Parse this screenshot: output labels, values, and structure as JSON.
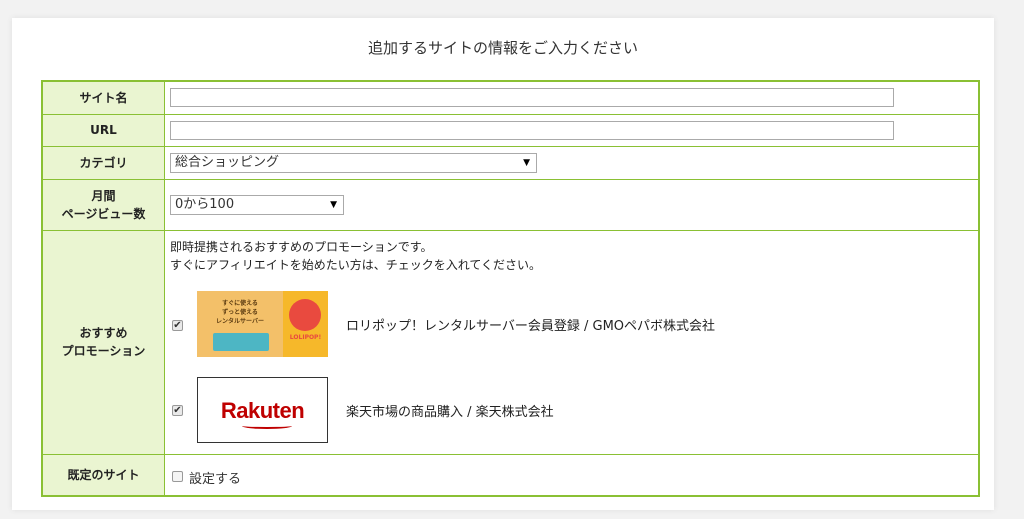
{
  "heading": "追加するサイトの情報をご入力ください",
  "colors": {
    "border": "#8ac034",
    "header_bg": "#eaf5d1",
    "rakuten_red": "#bf0000"
  },
  "rows": {
    "site_name": {
      "label": "サイト名",
      "value": ""
    },
    "url": {
      "label": "URL",
      "value": ""
    },
    "category": {
      "label": "カテゴリ",
      "selected": "総合ショッピング"
    },
    "pageviews": {
      "label_line1": "月間",
      "label_line2": "ページビュー数",
      "selected": "0から100"
    },
    "promotion": {
      "label_line1": "おすすめ",
      "label_line2": "プロモーション",
      "desc_line1": "即時提携されるおすすめのプロモーションです。",
      "desc_line2": "すぐにアフィリエイトを始めたい方は、チェックを入れてください。",
      "items": [
        {
          "checked": true,
          "text": "ロリポップ！レンタルサーバー会員登録 / GMOペパボ株式会社",
          "banner_lines": [
            "すぐに使える",
            "ずっと使える",
            "レンタルサーバー"
          ],
          "banner_logo": "LOLIPOP!"
        },
        {
          "checked": true,
          "text": "楽天市場の商品購入 / 楽天株式会社",
          "banner_logo": "Rakuten"
        }
      ]
    },
    "default_site": {
      "label": "既定のサイト",
      "checkbox_label": "設定する",
      "checked": false
    }
  }
}
